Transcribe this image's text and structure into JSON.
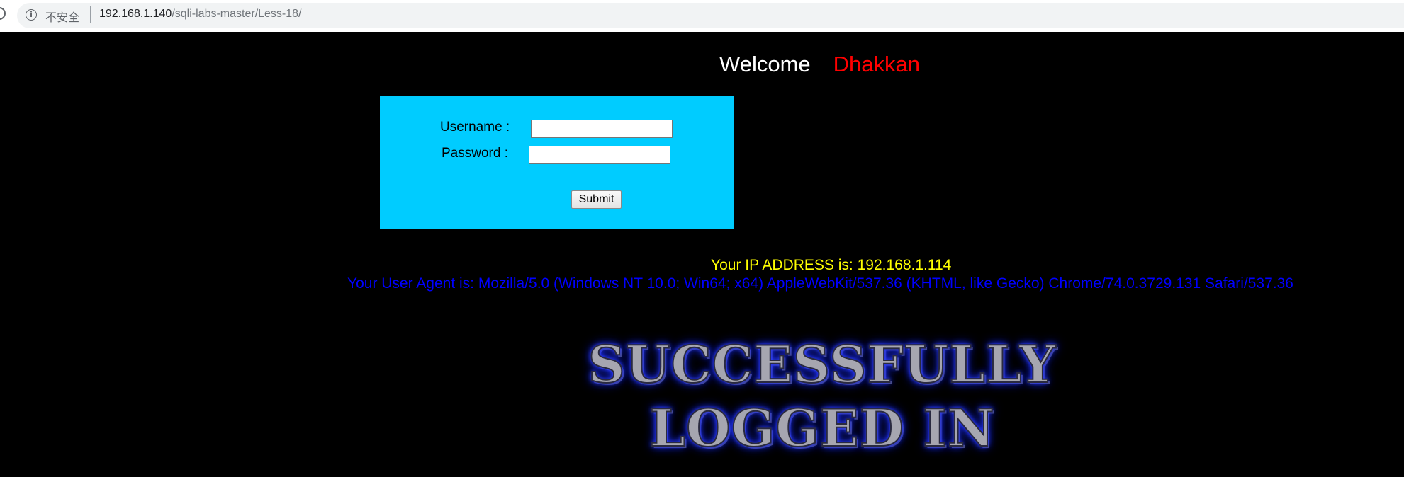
{
  "browser": {
    "security_label": "不安全",
    "url_host": "192.168.1.140",
    "url_path": "/sqli-labs-master/Less-18/"
  },
  "header": {
    "welcome": "Welcome",
    "name": "Dhakkan"
  },
  "form": {
    "username_label": "Username :",
    "password_label": "Password :",
    "username_value": "",
    "password_value": "",
    "submit_label": "Submit"
  },
  "result": {
    "ip_line": "Your IP ADDRESS is: 192.168.1.114",
    "user_agent_line": "Your User Agent is: Mozilla/5.0 (Windows NT 10.0; Win64; x64) AppleWebKit/537.36 (KHTML, like Gecko) Chrome/74.0.3729.131 Safari/537.36",
    "banner_line1": "SUCCESSFULLY",
    "banner_line2": "LOGGED IN"
  },
  "colors": {
    "background": "#000000",
    "form_bg": "#00ccff",
    "name": "#ff0000",
    "ip_text": "#ffff00",
    "ua_text": "#0000ff"
  }
}
